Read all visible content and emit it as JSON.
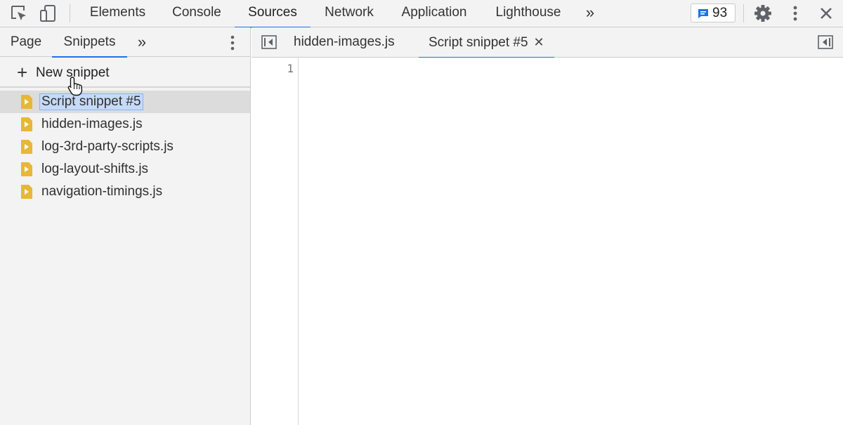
{
  "toolbar": {
    "inspect_icon": "inspect-element-icon",
    "device_icon": "device-toolbar-icon",
    "tabs": [
      {
        "label": "Elements",
        "active": false
      },
      {
        "label": "Console",
        "active": false
      },
      {
        "label": "Sources",
        "active": true
      },
      {
        "label": "Network",
        "active": false
      },
      {
        "label": "Application",
        "active": false
      },
      {
        "label": "Lighthouse",
        "active": false
      }
    ],
    "more_tabs": "»",
    "issues_count": "93",
    "settings_icon": "gear-icon",
    "menu_icon": "vertical-ellipsis-icon",
    "close_icon": "close-icon"
  },
  "navigator": {
    "tabs": [
      {
        "label": "Page",
        "active": false
      },
      {
        "label": "Snippets",
        "active": true
      }
    ],
    "more_tabs": "»",
    "new_snippet_plus": "+",
    "new_snippet_label": "New snippet",
    "files": [
      {
        "name": "Script snippet #5",
        "selected": true
      },
      {
        "name": "hidden-images.js",
        "selected": false
      },
      {
        "name": "log-3rd-party-scripts.js",
        "selected": false
      },
      {
        "name": "log-layout-shifts.js",
        "selected": false
      },
      {
        "name": "navigation-timings.js",
        "selected": false
      }
    ]
  },
  "editor": {
    "tabs": [
      {
        "label": "hidden-images.js",
        "active": false
      },
      {
        "label": "Script snippet #5",
        "active": true,
        "closable": true
      }
    ],
    "close_glyph": "✕",
    "line_numbers": [
      "1"
    ]
  },
  "colors": {
    "accent": "#1a73e8",
    "snippet_icon": "#e8b737",
    "selection": "#c5daf7"
  }
}
